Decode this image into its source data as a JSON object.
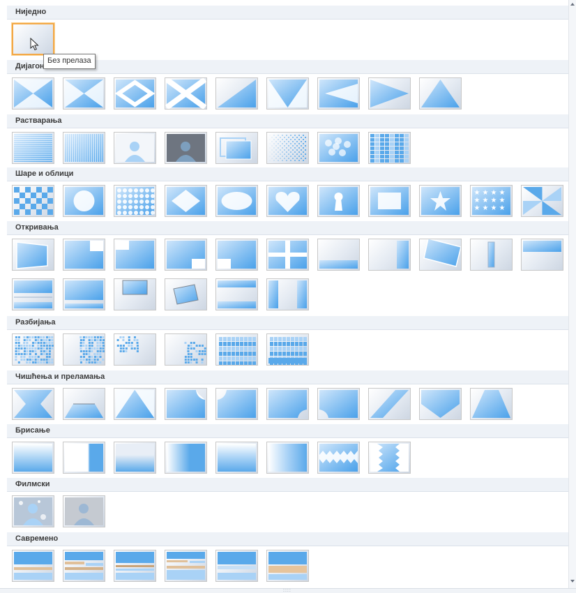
{
  "gallery": {
    "sections": [
      {
        "title": "Ниједно",
        "items": [
          {
            "name": "Без прелаза",
            "glyph": "none-icon"
          }
        ]
      },
      {
        "title": "Дијагонале",
        "items": [
          {
            "glyph": "diag-x-in-icon"
          },
          {
            "glyph": "diag-x-out-icon"
          },
          {
            "glyph": "diag-diamond-icon"
          },
          {
            "glyph": "diag-cross-icon"
          },
          {
            "glyph": "diag-wedge-icon"
          },
          {
            "glyph": "diag-v-down-icon"
          },
          {
            "glyph": "diag-arrow-left-icon"
          },
          {
            "glyph": "diag-arrow-right-icon"
          },
          {
            "glyph": "diag-v-up-icon"
          }
        ]
      },
      {
        "title": "Растварања",
        "items": [
          {
            "glyph": "dissolve-horizontal-lines-icon"
          },
          {
            "glyph": "dissolve-vertical-lines-icon"
          },
          {
            "glyph": "dissolve-fade-icon"
          },
          {
            "glyph": "dissolve-dark-icon"
          },
          {
            "glyph": "dissolve-zoom-icon"
          },
          {
            "glyph": "dissolve-dots-icon"
          },
          {
            "glyph": "dissolve-cloud-icon"
          },
          {
            "glyph": "dissolve-blocks-icon"
          }
        ]
      },
      {
        "title": "Шаре и облици",
        "items": [
          {
            "glyph": "pattern-checker-icon"
          },
          {
            "glyph": "shape-circle-icon"
          },
          {
            "glyph": "pattern-dots-icon"
          },
          {
            "glyph": "shape-diamond-icon"
          },
          {
            "glyph": "shape-oval-icon"
          },
          {
            "glyph": "shape-heart-icon"
          },
          {
            "glyph": "shape-keyhole-icon"
          },
          {
            "glyph": "shape-rectangle-icon"
          },
          {
            "glyph": "shape-star-icon"
          },
          {
            "glyph": "pattern-stars-icon"
          },
          {
            "glyph": "shape-pinwheel-icon"
          }
        ]
      },
      {
        "title": "Откривања",
        "items": [
          {
            "glyph": "reveal-door-icon"
          },
          {
            "glyph": "reveal-corner-tr-icon"
          },
          {
            "glyph": "reveal-corner-tl-icon"
          },
          {
            "glyph": "reveal-corner-br-icon"
          },
          {
            "glyph": "reveal-corner-bl-icon"
          },
          {
            "glyph": "reveal-split-icon"
          },
          {
            "glyph": "reveal-bottom-bar-icon"
          },
          {
            "glyph": "reveal-right-bar-icon"
          },
          {
            "glyph": "reveal-rotate-icon"
          },
          {
            "glyph": "reveal-center-bar-icon"
          },
          {
            "glyph": "reveal-top-bar-icon"
          },
          {
            "glyph": "reveal-push-down-icon"
          },
          {
            "glyph": "reveal-push-up-icon"
          },
          {
            "glyph": "reveal-drop-icon"
          },
          {
            "glyph": "reveal-tilt-icon"
          },
          {
            "glyph": "reveal-h-split-icon"
          },
          {
            "glyph": "reveal-v-split-icon"
          }
        ]
      },
      {
        "title": "Разбијања",
        "items": [
          {
            "glyph": "shatter-full-icon"
          },
          {
            "glyph": "shatter-right-icon"
          },
          {
            "glyph": "shatter-topleft-icon"
          },
          {
            "glyph": "shatter-bottomright-icon"
          },
          {
            "glyph": "shatter-grid-icon"
          },
          {
            "glyph": "shatter-grid-fall-icon"
          }
        ]
      },
      {
        "title": "Чишћења и преламања",
        "items": [
          {
            "glyph": "sweep-hourglass-icon"
          },
          {
            "glyph": "sweep-trapezoid-icon"
          },
          {
            "glyph": "sweep-triangle-icon"
          },
          {
            "glyph": "curl-top-right-icon"
          },
          {
            "glyph": "curl-top-left-icon"
          },
          {
            "glyph": "curl-bottom-right-icon"
          },
          {
            "glyph": "curl-bottom-left-icon"
          },
          {
            "glyph": "sweep-diagonal-icon"
          },
          {
            "glyph": "sweep-v-icon"
          },
          {
            "glyph": "sweep-peak-icon"
          }
        ]
      },
      {
        "title": "Брисање",
        "items": [
          {
            "glyph": "wipe-up-icon"
          },
          {
            "glyph": "wipe-left-icon"
          },
          {
            "glyph": "wipe-down-icon"
          },
          {
            "glyph": "wipe-right-icon"
          },
          {
            "glyph": "wipe-up-soft-icon"
          },
          {
            "glyph": "wipe-right-soft-icon"
          },
          {
            "glyph": "wipe-zigzag-h-icon"
          },
          {
            "glyph": "wipe-zigzag-v-icon"
          }
        ]
      },
      {
        "title": "Филмски",
        "items": [
          {
            "glyph": "cinematic-sparkle-icon"
          },
          {
            "glyph": "cinematic-fade-icon"
          }
        ]
      },
      {
        "title": "Савремено",
        "items": [
          {
            "glyph": "modern-stripes-1-icon"
          },
          {
            "glyph": "modern-stripes-2-icon"
          },
          {
            "glyph": "modern-stripes-3-icon"
          },
          {
            "glyph": "modern-stripes-4-icon"
          },
          {
            "glyph": "modern-stripes-5-icon"
          },
          {
            "glyph": "modern-stripes-6-icon"
          }
        ]
      }
    ],
    "selected": "Без прелаза"
  },
  "tooltip": {
    "text": "Без прелаза"
  },
  "colors": {
    "accent_blue": "#5aa9ea",
    "selection_border": "#f3a847",
    "header_bg": "#eef2f7"
  }
}
